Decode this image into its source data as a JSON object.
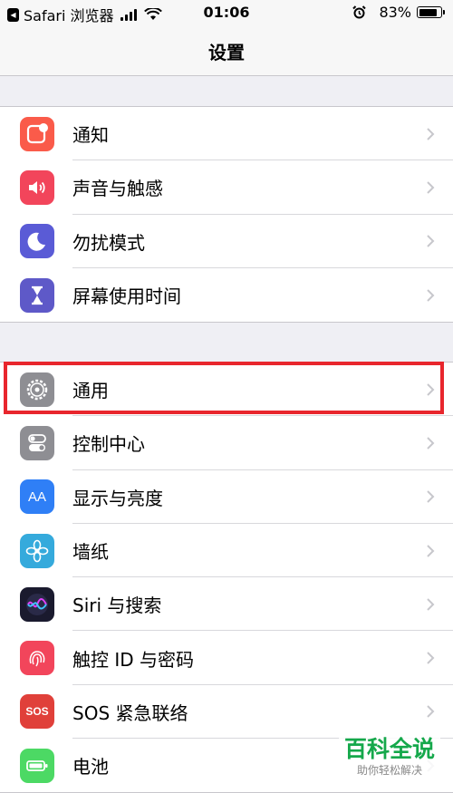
{
  "status_bar": {
    "back_app": "Safari 浏览器",
    "time": "01:06",
    "battery_percent": "83%",
    "battery_level": 0.83
  },
  "nav": {
    "title": "设置"
  },
  "group1": [
    {
      "label": "通知",
      "icon": "notifications-icon",
      "color": "#fa5b4a"
    },
    {
      "label": "声音与触感",
      "icon": "speaker-icon",
      "color": "#f2455b"
    },
    {
      "label": "勿扰模式",
      "icon": "moon-icon",
      "color": "#5a5bd6"
    },
    {
      "label": "屏幕使用时间",
      "icon": "hourglass-icon",
      "color": "#5e59c8"
    }
  ],
  "group2": [
    {
      "label": "通用",
      "icon": "gear-icon",
      "color": "#8e8e93"
    },
    {
      "label": "控制中心",
      "icon": "toggles-icon",
      "color": "#8e8e93"
    },
    {
      "label": "显示与亮度",
      "icon": "text-size-icon",
      "color": "#2f7ff6",
      "icon_text": "AA"
    },
    {
      "label": "墙纸",
      "icon": "flower-icon",
      "color": "#35aadc"
    },
    {
      "label": "Siri 与搜索",
      "icon": "siri-icon",
      "color": "#1a1a2e"
    },
    {
      "label": "触控 ID 与密码",
      "icon": "fingerprint-icon",
      "color": "#f2455b"
    },
    {
      "label": "SOS 紧急联络",
      "icon": "sos-icon",
      "color": "#e0403a",
      "icon_text": "SOS"
    },
    {
      "label": "电池",
      "icon": "battery-icon",
      "color": "#4cd964"
    }
  ],
  "watermark": {
    "logo": "百科全说",
    "subtitle": "助你轻松解决"
  },
  "highlight_color": "#e8262d"
}
